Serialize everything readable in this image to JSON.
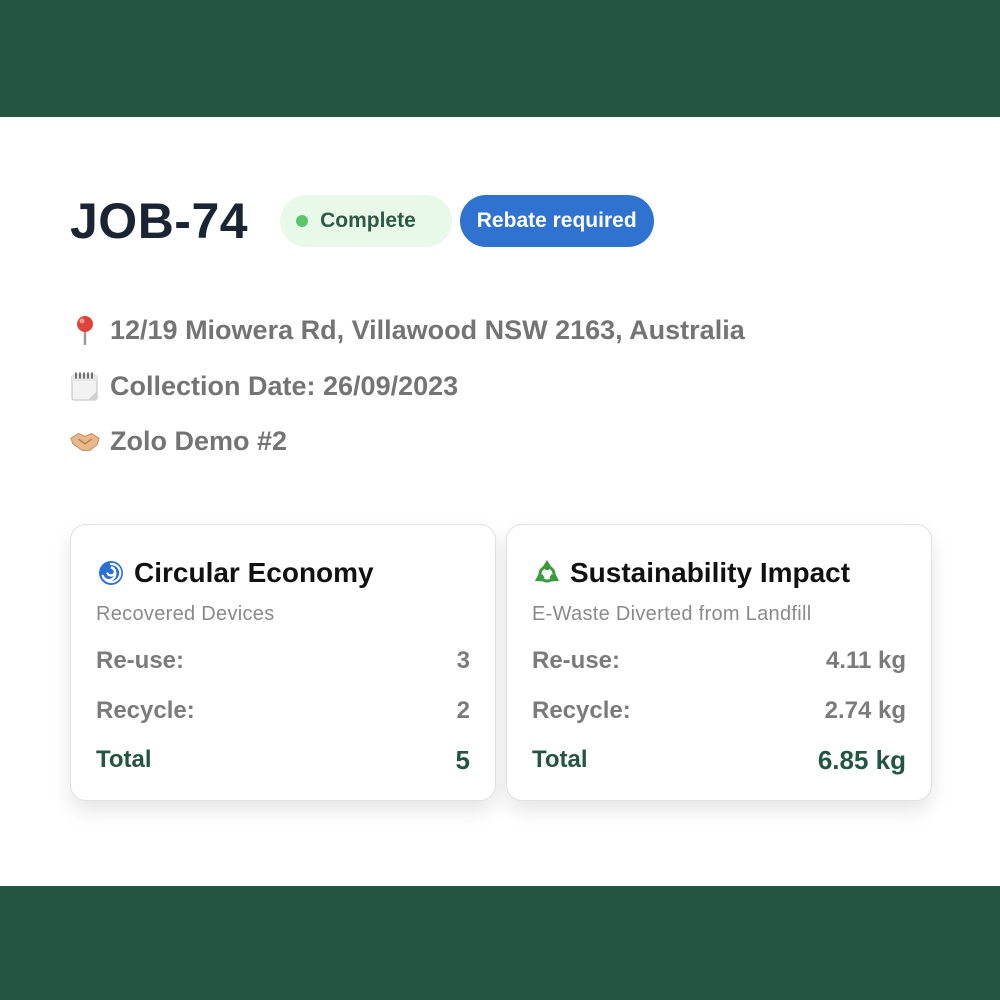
{
  "colors": {
    "brand_dark_green": "#245442",
    "complete_badge_bg": "#e9f9e9",
    "complete_dot": "#5cc56b",
    "rebate_badge_bg": "#2f72cf"
  },
  "job": {
    "id": "JOB-74",
    "badges": {
      "complete": "Complete",
      "rebate": "Rebate required"
    }
  },
  "details": {
    "address": {
      "icon": "pin-icon",
      "text": "12/19 Miowera Rd, Villawood NSW 2163, Australia"
    },
    "collection": {
      "icon": "calendar-icon",
      "text": "Collection Date: 26/09/2023"
    },
    "partner": {
      "icon": "handshake-icon",
      "text": "Zolo Demo #2"
    }
  },
  "cards": [
    {
      "icon": "cyclone-icon",
      "title": "Circular Economy",
      "subtitle": "Recovered Devices",
      "rows": [
        {
          "label": "Re-use:",
          "value": "3"
        },
        {
          "label": "Recycle:",
          "value": "2"
        },
        {
          "label": "Total",
          "value": "5"
        }
      ]
    },
    {
      "icon": "recycle-icon",
      "title": "Sustainability Impact",
      "subtitle": "E-Waste Diverted from Landfill",
      "rows": [
        {
          "label": "Re-use:",
          "value": "4.11 kg"
        },
        {
          "label": "Recycle:",
          "value": "2.74 kg"
        },
        {
          "label": "Total",
          "value": "6.85 kg"
        }
      ]
    }
  ]
}
